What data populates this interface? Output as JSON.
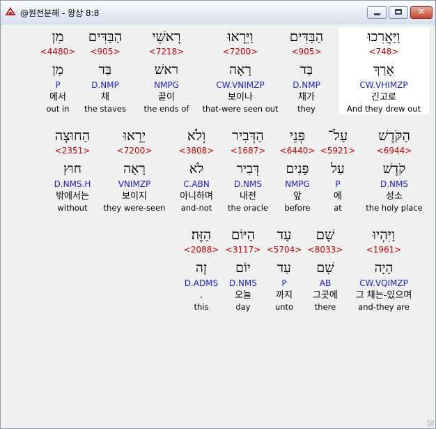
{
  "window": {
    "title": "@원전분해 - 왕상 8:8"
  },
  "colors": {
    "strong": "#c00000",
    "morph": "#2020c0",
    "selected_bg": "#ffffff"
  },
  "rows": [
    [
      {
        "hebrew": "וַיַּאֲרִכוּ",
        "strong": "<748>",
        "lemma": "אָרַךְ",
        "morph": "CW.VHIMZP",
        "korean": "긴고로",
        "english": "And they drew out",
        "selected": true
      },
      {
        "hebrew": "הַבַּדִּים",
        "strong": "<905>",
        "lemma": "בַּד",
        "morph": "D.NMP",
        "korean": "채가",
        "english": "they"
      },
      {
        "hebrew": "וַיֵּרָאוּ",
        "strong": "<7200>",
        "lemma": "רָאָה",
        "morph": "CW.VNIMZP",
        "korean": "보이나",
        "english": "that-were seen out"
      },
      {
        "hebrew": "רָאשֵׁי",
        "strong": "<7218>",
        "lemma": "ראשׁ",
        "morph": "NMPG",
        "korean": "끝이",
        "english": "the ends of"
      },
      {
        "hebrew": "הַבַּדִּים",
        "strong": "<905>",
        "lemma": "בַּד",
        "morph": "D.NMP",
        "korean": "채",
        "english": "the staves"
      },
      {
        "hebrew": "מִן",
        "strong": "<4480>",
        "lemma": "מִן",
        "morph": "P",
        "korean": "에서",
        "english": "out in"
      }
    ],
    [
      {
        "hebrew": "הַקֹּדֶשׁ",
        "strong": "<6944>",
        "lemma": "קֹדֶשׁ",
        "morph": "D.NMS",
        "korean": "성소",
        "english": "the holy place"
      },
      {
        "hebrew": "עַל־",
        "strong": "<5921>",
        "lemma": "עַל",
        "morph": "P",
        "korean": "에",
        "english": "at"
      },
      {
        "hebrew": "פְּנֵי",
        "strong": "<6440>",
        "lemma": "פָּנִים",
        "morph": "NMPG",
        "korean": "앞",
        "english": "before"
      },
      {
        "hebrew": "הַדְּבִיר",
        "strong": "<1687>",
        "lemma": "דְּבִיר",
        "morph": "D.NMS",
        "korean": "내전",
        "english": "the oracle"
      },
      {
        "hebrew": "וְלֹא",
        "strong": "<3808>",
        "lemma": "לֹא",
        "morph": "C.ABN",
        "korean": "아니하며",
        "english": "and-not"
      },
      {
        "hebrew": "יֵרָאוּ",
        "strong": "<7200>",
        "lemma": "רָאָה",
        "morph": "VNIMZP",
        "korean": "보이지",
        "english": "they were-seen"
      },
      {
        "hebrew": "הַחוּצָה",
        "strong": "<2351>",
        "lemma": "חוּץ",
        "morph": "D.NMS.H",
        "korean": "밖에서는",
        "english": "without"
      }
    ],
    [
      {
        "hebrew": "וַיִּהְיוּ",
        "strong": "<1961>",
        "lemma": "הָיָה",
        "morph": "CW.VQIMZP",
        "korean": "그 채는-있으며",
        "english": "and-they are"
      },
      {
        "hebrew": "שָׁם",
        "strong": "<8033>",
        "lemma": "שָׁם",
        "morph": "AB",
        "korean": "그곳에",
        "english": "there"
      },
      {
        "hebrew": "עַד",
        "strong": "<5704>",
        "lemma": "עַד",
        "morph": "P",
        "korean": "까지",
        "english": "unto"
      },
      {
        "hebrew": "הַיּוֹם",
        "strong": "<3117>",
        "lemma": "יוֹם",
        "morph": "D.NMS",
        "korean": "오늘",
        "english": "day"
      },
      {
        "hebrew": "הַזֶּה׃",
        "strong": "<2088>",
        "lemma": "זֶה",
        "morph": "D.ADMS",
        "korean": ".",
        "english": "this"
      }
    ]
  ]
}
